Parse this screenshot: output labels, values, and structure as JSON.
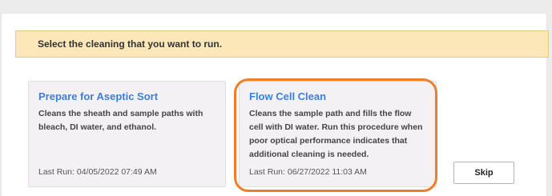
{
  "banner": {
    "instruction": "Select the cleaning that you want to run."
  },
  "options": [
    {
      "title": "Prepare for Aseptic Sort",
      "description": "Cleans the sheath and sample paths with bleach, DI water, and ethanol.",
      "last_run": "Last Run: 04/05/2022 07:49 AM"
    },
    {
      "title": "Flow Cell Clean",
      "description": "Cleans the sample path and fills the flow cell with DI water. Run this procedure when poor optical performance indicates that additional cleaning is needed.",
      "last_run": "Last Run: 06/27/2022 11:03 AM",
      "highlighted": true
    }
  ],
  "actions": {
    "skip_label": "Skip"
  },
  "colors": {
    "title_blue": "#3b7fd6",
    "banner_bg": "#fbe7b8",
    "highlight_orange": "#f07d28"
  }
}
